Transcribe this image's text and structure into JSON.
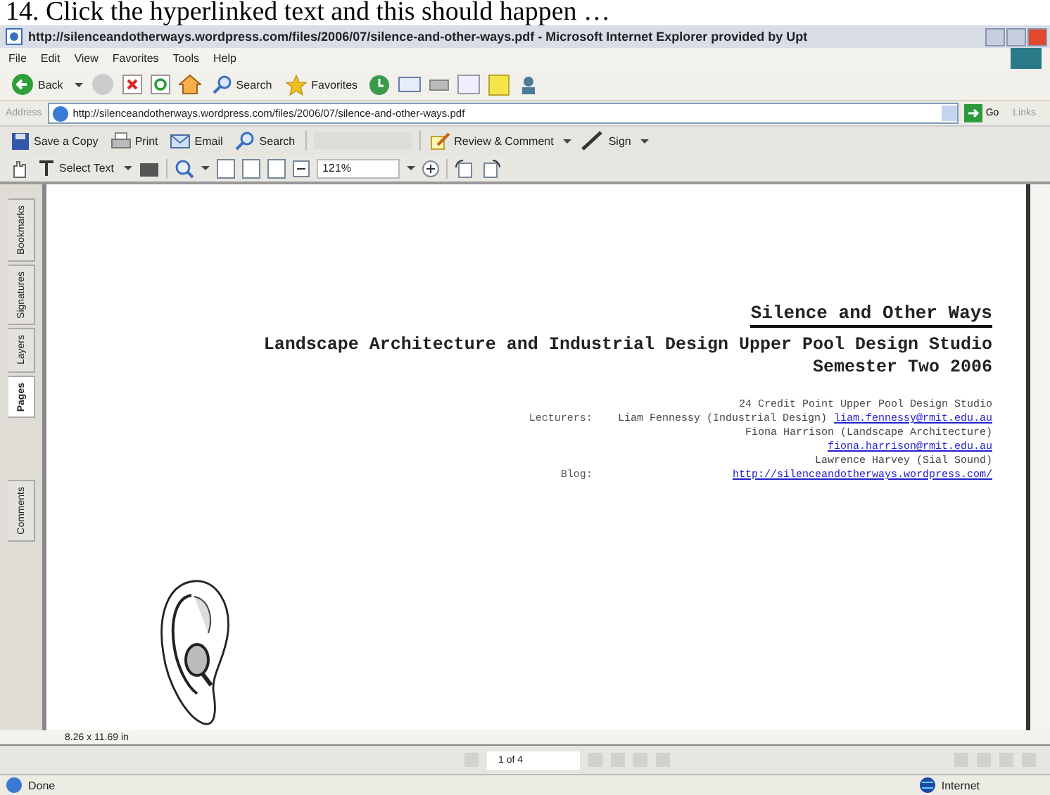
{
  "caption": "14. Click the hyperlinked text and this should happen …",
  "window": {
    "title": "http://silenceandotherways.wordpress.com/files/2006/07/silence-and-other-ways.pdf - Microsoft Internet Explorer provided by Upt"
  },
  "menu": [
    "File",
    "Edit",
    "View",
    "Favorites",
    "Tools",
    "Help"
  ],
  "ie_toolbar": [
    {
      "kind": "back",
      "label": "Back"
    },
    {
      "kind": "search",
      "label": "Search"
    },
    {
      "kind": "favorites",
      "label": "Favorites"
    }
  ],
  "address": {
    "label": "Address",
    "value": "http://silenceandotherways.wordpress.com/files/2006/07/silence-and-other-ways.pdf",
    "go": "Go",
    "links": "Links"
  },
  "acrobat_toolbar": [
    {
      "kind": "save",
      "label": "Save a Copy"
    },
    {
      "kind": "print",
      "label": "Print"
    },
    {
      "kind": "email",
      "label": "Email"
    },
    {
      "kind": "search",
      "label": "Search"
    },
    {
      "kind": "review",
      "label": "Review & Comment"
    },
    {
      "kind": "sign",
      "label": "Sign"
    }
  ],
  "view_toolbar": {
    "select": "Select Text",
    "zoom": "121%"
  },
  "side_tabs": [
    {
      "label": "Bookmarks",
      "selected": false
    },
    {
      "label": "Signatures",
      "selected": false
    },
    {
      "label": "Layers",
      "selected": false
    },
    {
      "label": "Pages",
      "selected": true
    },
    {
      "label": "Comments",
      "selected": false
    }
  ],
  "document": {
    "title": "Silence and Other Ways",
    "subtitle": [
      "Landscape Architecture and Industrial Design Upper Pool Design Studio",
      "Semester Two 2006"
    ],
    "details": [
      {
        "parts": [
          {
            "text": "24 Credit Point Upper Pool Design Studio",
            "link": false
          }
        ]
      },
      {
        "label": "Lecturers:",
        "parts": [
          {
            "text": "Liam Fennessy (Industrial Design)",
            "link": false
          },
          {
            "text": "liam.fennessy@rmit.edu.au",
            "link": true
          }
        ]
      },
      {
        "parts": [
          {
            "text": "Fiona Harrison (Landscape Architecture)",
            "link": false
          }
        ]
      },
      {
        "parts": [
          {
            "text": "fiona.harrison@rmit.edu.au",
            "link": true
          }
        ]
      },
      {
        "parts": [
          {
            "text": "Lawrence Harvey (Sial Sound)",
            "link": false
          }
        ]
      },
      {
        "label": "Blog:",
        "parts": [
          {
            "text": "http://silenceandotherways.wordpress.com/",
            "link": true
          }
        ]
      }
    ]
  },
  "page_size": "8.26 x 11.69 in",
  "page_nav": "1 of 4",
  "status_bar": {
    "text": "Done",
    "zone": "Internet"
  }
}
